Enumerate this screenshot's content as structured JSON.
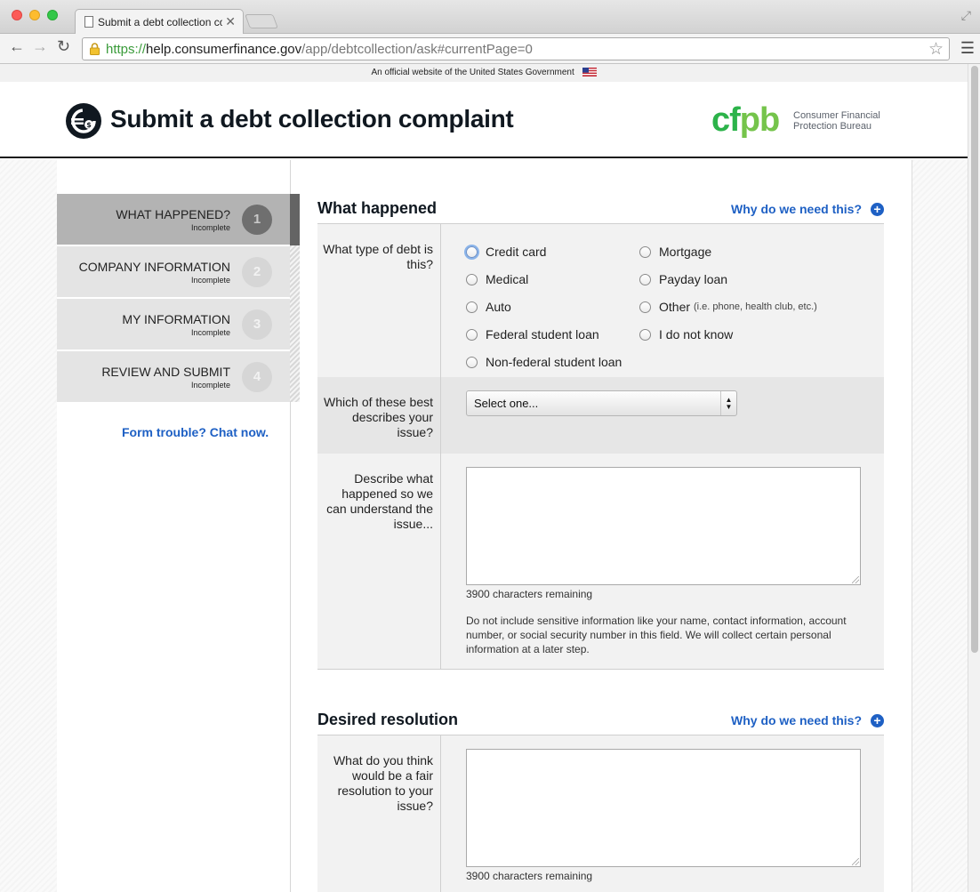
{
  "browser": {
    "tab_title": "Submit a debt collection co",
    "tab_close": "✕",
    "url_scheme": "https://",
    "url_host": "help.consumerfinance.gov",
    "url_path": "/app/debtcollection/ask#currentPage=0",
    "icons": {
      "back": "arrow-left-icon",
      "forward": "arrow-right-icon",
      "reload": "reload-icon",
      "star": "star-icon",
      "menu": "hamburger-menu-icon",
      "lock": "lock-icon"
    }
  },
  "gov_banner": {
    "text": "An official website of the United States Government"
  },
  "header": {
    "title": "Submit a debt collection complaint",
    "logo_cf": "cf",
    "logo_pb": "pb",
    "tagline_line1": "Consumer Financial",
    "tagline_line2": "Protection Bureau"
  },
  "steps": [
    {
      "name": "WHAT HAPPENED?",
      "status": "Incomplete",
      "number": "1",
      "active": true
    },
    {
      "name": "COMPANY INFORMATION",
      "status": "Incomplete",
      "number": "2",
      "active": false
    },
    {
      "name": "MY INFORMATION",
      "status": "Incomplete",
      "number": "3",
      "active": false
    },
    {
      "name": "REVIEW AND SUBMIT",
      "status": "Incomplete",
      "number": "4",
      "active": false
    }
  ],
  "sidebar": {
    "chat_link": "Form trouble? Chat now."
  },
  "what_happened": {
    "title": "What happened",
    "why_link": "Why do we need this?",
    "debt_type": {
      "label": "What type of debt is this?",
      "options": [
        "Credit card",
        "Mortgage",
        "Medical",
        "Payday loan",
        "Auto",
        "Other",
        "Federal student loan",
        "I do not know",
        "Non-federal student loan"
      ],
      "other_hint": "(i.e. phone, health club, etc.)"
    },
    "issue": {
      "label": "Which of these best describes your issue?",
      "selected": "Select one..."
    },
    "describe": {
      "label": "Describe what happened so we can understand the issue...",
      "value": "",
      "remaining": "3900 characters remaining",
      "disclaimer": "Do not include sensitive information like your name, contact information, account number, or social security number in this field. We will collect certain personal information at a later step."
    }
  },
  "desired_resolution": {
    "title": "Desired resolution",
    "why_link": "Why do we need this?",
    "label": "What do you think would be a fair resolution to your issue?",
    "value": "",
    "remaining": "3900 characters remaining"
  },
  "colors": {
    "link": "#1e60c4",
    "cfpb_green": "#2cb34a",
    "cfpb_light_green": "#75c44b",
    "active_step": "#b3b3b3",
    "step_bg": "#e4e4e4"
  }
}
